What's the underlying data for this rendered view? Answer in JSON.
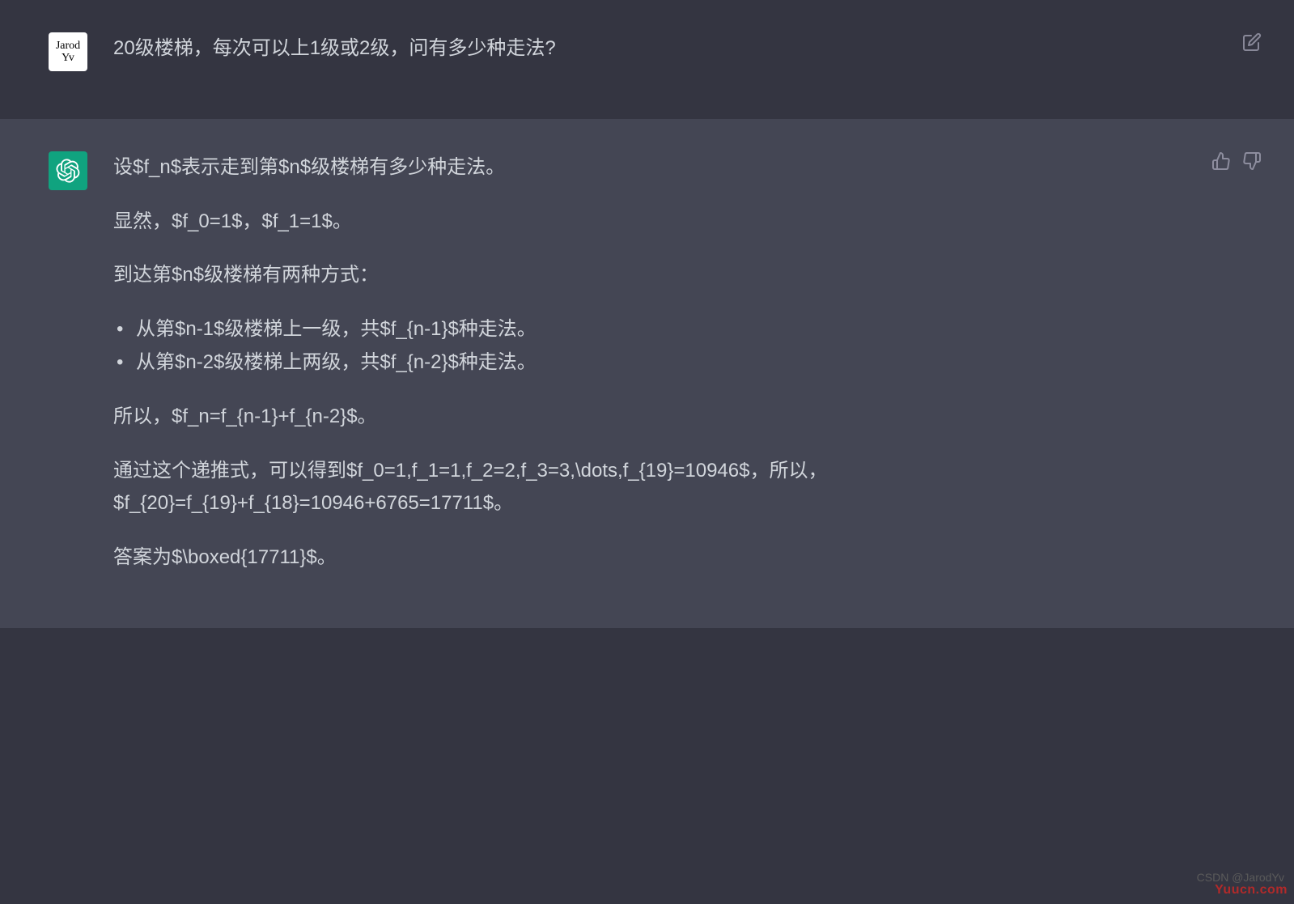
{
  "user": {
    "avatar_text": "Jarod Yv",
    "question": "20级楼梯，每次可以上1级或2级，问有多少种走法?"
  },
  "assistant": {
    "p1": "设$f_n$表示走到第$n$级楼梯有多少种走法。",
    "p2": "显然，$f_0=1$，$f_1=1$。",
    "p3": "到达第$n$级楼梯有两种方式：",
    "li1": "从第$n-1$级楼梯上一级，共$f_{n-1}$种走法。",
    "li2": "从第$n-2$级楼梯上两级，共$f_{n-2}$种走法。",
    "p4": "所以，$f_n=f_{n-1}+f_{n-2}$。",
    "p5": "通过这个递推式，可以得到$f_0=1,f_1=1,f_2=2,f_3=3,\\dots,f_{19}=10946$，所以，$f_{20}=f_{19}+f_{18}=10946+6765=17711$。",
    "p6": "答案为$\\boxed{17711}$。"
  },
  "watermarks": {
    "csdn": "CSDN @JarodYv",
    "yuucn": "Yuucn.com"
  }
}
